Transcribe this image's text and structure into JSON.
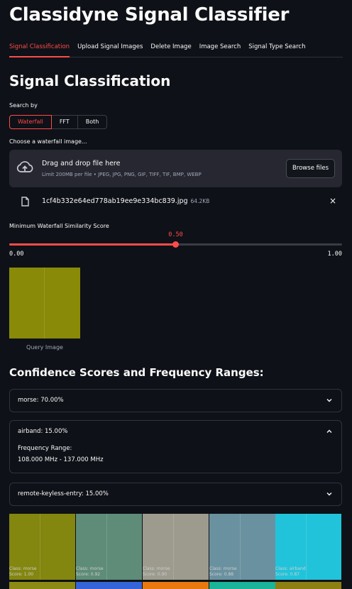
{
  "app": {
    "title": "Classidyne Signal Classifier"
  },
  "tabs": [
    "Signal Classification",
    "Upload Signal Images",
    "Delete Image",
    "Image Search",
    "Signal Type Search"
  ],
  "active_tab": "Signal Classification",
  "section": {
    "title": "Signal Classification"
  },
  "search_by": {
    "label": "Search by",
    "options": [
      "Waterfall",
      "FFT",
      "Both"
    ],
    "selected": "Waterfall"
  },
  "uploader": {
    "label": "Choose a waterfall image...",
    "title": "Drag and drop file here",
    "subtitle": "Limit 200MB per file • JPEG, JPG, PNG, GIF, TIFF, TIF, BMP, WEBP",
    "browse_label": "Browse files",
    "file_name": "1cf4b332e64ed778ab19ee9e334bc839.jpg",
    "file_size": "64.2KB",
    "close_symbol": "×"
  },
  "slider": {
    "label": "Minimum Waterfall Similarity Score",
    "value": 0.5,
    "value_text": "0.50",
    "min_text": "0.00",
    "max_text": "1.00",
    "min": 0,
    "max": 1
  },
  "query": {
    "caption": "Query Image",
    "color": "#8a8a09"
  },
  "confidence": {
    "title": "Confidence Scores and Frequency Ranges:",
    "items": [
      {
        "label": "morse: 70.00%",
        "expanded": false
      },
      {
        "label": "airband: 15.00%",
        "expanded": true,
        "range_label": "Frequency Range:",
        "range_value": "108.000 MHz - 137.000 MHz"
      },
      {
        "label": "remote-keyless-entry: 15.00%",
        "expanded": false
      }
    ]
  },
  "results": [
    {
      "class_text": "Class: morse",
      "score_text": "Score: 1.00",
      "color": "#83860f"
    },
    {
      "class_text": "Class: morse",
      "score_text": "Score: 0.92",
      "color": "#5e8c78"
    },
    {
      "class_text": "Class: morse",
      "score_text": "Score: 0.90",
      "color": "#9c9b8e"
    },
    {
      "class_text": "Class: morse",
      "score_text": "Score: 0.88",
      "color": "#6a91a0"
    },
    {
      "class_text": "Class: airband",
      "score_text": "Score: 0.87",
      "color": "#21c3da"
    }
  ],
  "results_row2_colors": [
    "#8b8a14",
    "#3564d9",
    "#e9780f",
    "#19b49a",
    "#8d7f12"
  ],
  "icons": {
    "upload": "cloud-upload-icon",
    "file": "file-icon",
    "close": "close-icon",
    "chevron_down": "chevron-down-icon",
    "chevron_up": "chevron-up-icon"
  },
  "colors": {
    "accent": "#ff4b4b",
    "background": "#0e1117",
    "panel": "#262730"
  }
}
